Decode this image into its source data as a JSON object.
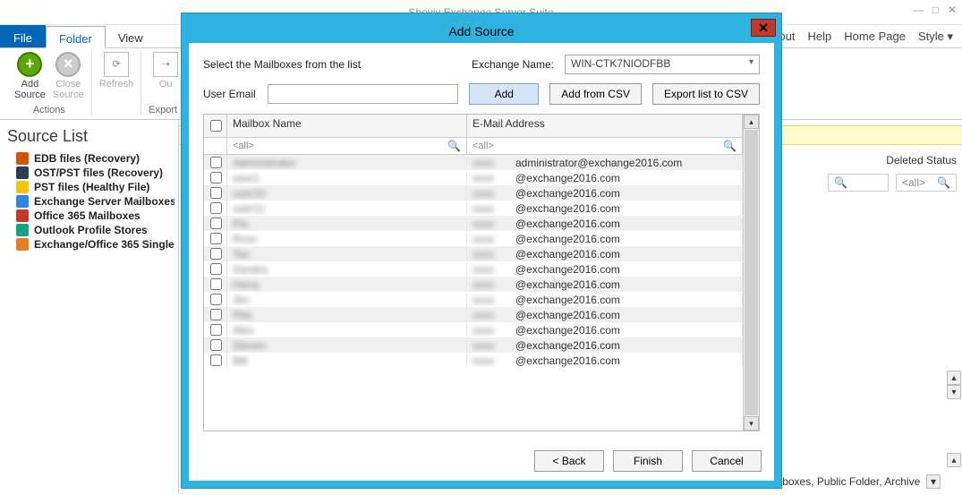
{
  "app": {
    "title": "Shoviv Exchange Server Suite",
    "menu": {
      "file": "File",
      "folder": "Folder",
      "view": "View"
    },
    "right_menu": {
      "about": "About",
      "help": "Help",
      "home": "Home Page",
      "style": "Style"
    }
  },
  "ribbon": {
    "add_source": "Add\nSource",
    "close_source": "Close\nSource",
    "refresh": "Refresh",
    "export_label": "Export I",
    "ou_label": "Ou",
    "group_actions": "Actions"
  },
  "sidebar": {
    "title": "Source List",
    "items": [
      {
        "label": "EDB files (Recovery)",
        "color": "#d35400"
      },
      {
        "label": "OST/PST files (Recovery)",
        "color": "#2c3e50"
      },
      {
        "label": "PST files (Healthy File)",
        "color": "#f1c40f"
      },
      {
        "label": "Exchange Server Mailboxes",
        "color": "#2e86de"
      },
      {
        "label": "Office 365 Mailboxes",
        "color": "#c0392b"
      },
      {
        "label": "Outlook Profile Stores",
        "color": "#16a085"
      },
      {
        "label": "Exchange/Office 365 Single",
        "color": "#e67e22"
      }
    ]
  },
  "grid": {
    "deleted_col": "Deleted Status",
    "filter_placeholder": "<all>"
  },
  "footer": "ailboxes, Public Folder, Archive",
  "modal": {
    "title": "Add Source",
    "instruction": "Select the Mailboxes from the list",
    "exchange_label": "Exchange Name:",
    "exchange_value": "WIN-CTK7NIODFBB",
    "user_email_label": "User Email",
    "buttons": {
      "add": "Add",
      "add_csv": "Add from CSV",
      "export_csv": "Export list to CSV",
      "back": "< Back",
      "finish": "Finish",
      "cancel": "Cancel"
    },
    "grid": {
      "col_name": "Mailbox Name",
      "col_email": "E-Mail Address",
      "filter": "<all>",
      "rows": [
        {
          "name": "Administrator",
          "email": "administrator@exchange2016.com"
        },
        {
          "name": "user1",
          "email": "@exchange2016.com"
        },
        {
          "name": "user10",
          "email": "@exchange2016.com"
        },
        {
          "name": "user11",
          "email": "@exchange2016.com"
        },
        {
          "name": "Pia",
          "email": "@exchange2016.com"
        },
        {
          "name": "Russ",
          "email": "@exchange2016.com"
        },
        {
          "name": "Tan",
          "email": "@exchange2016.com"
        },
        {
          "name": "Sandra",
          "email": "@exchange2016.com"
        },
        {
          "name": "Harry",
          "email": "@exchange2016.com"
        },
        {
          "name": "Jim",
          "email": "@exchange2016.com"
        },
        {
          "name": "Rita",
          "email": "@exchange2016.com"
        },
        {
          "name": "Alex",
          "email": "@exchange2016.com"
        },
        {
          "name": "Steven",
          "email": "@exchange2016.com"
        },
        {
          "name": "Bill",
          "email": "@exchange2016.com"
        }
      ]
    }
  }
}
